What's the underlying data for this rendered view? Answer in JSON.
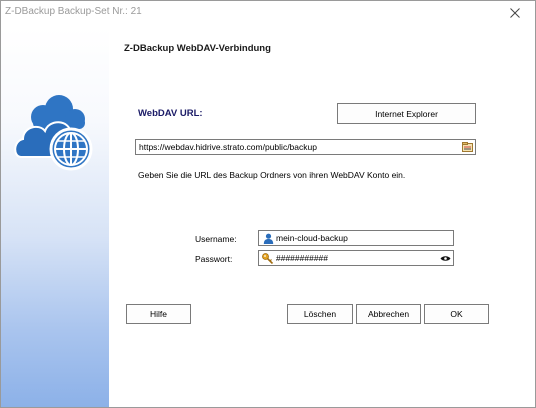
{
  "window": {
    "title": "Z-DBackup Backup-Set Nr.: 21"
  },
  "dialog": {
    "heading": "Z-DBackup WebDAV-Verbindung",
    "url_label": "WebDAV URL:",
    "browser_button": "Internet Explorer",
    "url_value": "https://webdav.hidrive.strato.com/public/backup",
    "hint": "Geben Sie die URL des Backup Ordners von ihren WebDAV Konto ein.",
    "username_label": "Username:",
    "username_value": "mein-cloud-backup",
    "password_label": "Passwort:",
    "password_value": "###########"
  },
  "buttons": {
    "help": "Hilfe",
    "delete": "Löschen",
    "cancel": "Abbrechen",
    "ok": "OK"
  },
  "icons": {
    "close": "close-icon",
    "logo": "cloud-globe-icon",
    "url_browse": "browse-icon",
    "user": "user-icon",
    "key": "key-icon",
    "reveal": "eye-icon"
  },
  "colors": {
    "accent": "#2a6dbb",
    "logo_blue": "#2f75c4",
    "heading_text": "#1a1a66"
  }
}
